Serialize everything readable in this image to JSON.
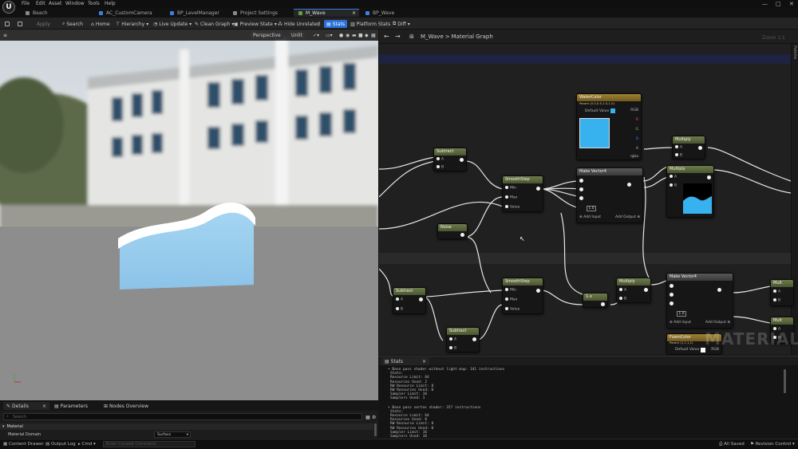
{
  "menu": {
    "logo": "U",
    "items": [
      "File",
      "Edit",
      "Asset",
      "Window",
      "Tools",
      "Help"
    ],
    "window_controls": [
      "—",
      "□",
      "✕"
    ]
  },
  "tabs": [
    {
      "label": "Beach",
      "color": "#888"
    },
    {
      "label": "AC_CustomCamera",
      "color": "#3d7fe0"
    },
    {
      "label": "BP_LevelManager",
      "color": "#3d7fe0"
    },
    {
      "label": "Project Settings",
      "color": "#888"
    },
    {
      "label": "M_Wave",
      "color": "#6b9c3f"
    },
    {
      "label": "BP_Wave",
      "color": "#3d7fe0"
    }
  ],
  "toolbar": {
    "apply": "Apply",
    "search": "Search",
    "home": "Home",
    "hierarchy": "Hierarchy",
    "live_update": "Live Update",
    "clean_graph": "Clean Graph",
    "preview_state": "Preview State",
    "hide_unrelated": "Hide Unrelated",
    "stats": "Stats",
    "platform_stats": "Platform Stats",
    "diff": "Diff"
  },
  "viewport": {
    "perspective": "Perspective",
    "lit": "Unlit"
  },
  "graph": {
    "breadcrumb_asset": "M_Wave",
    "breadcrumb_sep": ">",
    "breadcrumb_graph": "Material Graph",
    "zoom": "Zoom 1:1",
    "palette": "Palette",
    "watermark": "MATERIAL",
    "nodes": {
      "water_color": {
        "title": "WaterColor",
        "subtitle": "Param (0.0,0.5,1.0,1.0)",
        "default_label": "Default Value",
        "out_rgb": "RGB",
        "out_r": "R",
        "out_g": "G",
        "out_b": "B",
        "out_a": "A",
        "out_rgba": "rgba"
      },
      "subtract1": {
        "title": "Subtract",
        "a": "A",
        "b": "B"
      },
      "smoothstep1": {
        "title": "SmoothStep",
        "min": "Min",
        "max": "Max",
        "value": "Value"
      },
      "make_vector1": {
        "title": "Make Vector4",
        "value": "1.0",
        "add_input": "Add Input",
        "add_output": "Add Output"
      },
      "multiply1": {
        "title": "Multiply",
        "a": "A",
        "b": "B"
      },
      "multiply2": {
        "title": "Multiply",
        "a": "A",
        "b": "B"
      },
      "noise": {
        "title": "Noise"
      },
      "subtract2": {
        "title": "Subtract",
        "a": "A",
        "b": "B"
      },
      "smoothstep2": {
        "title": "SmoothStep",
        "min": "Min",
        "max": "Max",
        "value": "Value"
      },
      "one_minus": {
        "title": "1-x"
      },
      "multiply3": {
        "title": "Multiply",
        "a": "A",
        "b": "B"
      },
      "make_vector2": {
        "title": "Make Vector4",
        "value": "1.0",
        "add_input": "Add Input",
        "add_output": "Add Output"
      },
      "subtract3": {
        "title": "Subtract",
        "a": "A",
        "b": "B"
      },
      "foam_color": {
        "title": "FoamColor",
        "subtitle": "Param (1,1,1,1)",
        "default_label": "Default Value",
        "out_rgb": "RGB"
      },
      "multiply4": {
        "title": "Mult",
        "a": "A",
        "b": "B"
      },
      "multiply5": {
        "title": "Mult",
        "a": "A",
        "b": "B"
      }
    }
  },
  "details": {
    "tabs": [
      "Details",
      "Parameters",
      "Nodes Overview"
    ],
    "search_placeholder": "Search",
    "section": "Material",
    "domain_label": "Material Domain",
    "domain_value": "Surface"
  },
  "stats": {
    "tab": "Stats",
    "lines": [
      "• Base pass shader without light map: 141 instructions",
      "Stats:",
      "Resource Limit: 64",
      "Resources Used: 2",
      "RW Resource Limit: 8",
      "RW Resources Used: 0",
      "Sampler Limit: 16",
      "Samplers Used: 1",
      "• Base pass vertex shader: 357 instructions",
      "Stats:",
      "Resource Limit: 64",
      "Resources Used: 0",
      "RW Resource Limit: 8",
      "RW Resources Used: 0",
      "Sampler Limit: 16",
      "Samplers Used: 16"
    ]
  },
  "status": {
    "content_drawer": "Content Drawer",
    "output_log": "Output Log",
    "cmd": "Cmd",
    "console_placeholder": "Enter Console Command",
    "all_saved": "All Saved",
    "revision": "Revision Control"
  },
  "colors": {
    "accent": "#2b6fd8",
    "water": "#37b2ee",
    "node_green": "#5f6d3e"
  }
}
